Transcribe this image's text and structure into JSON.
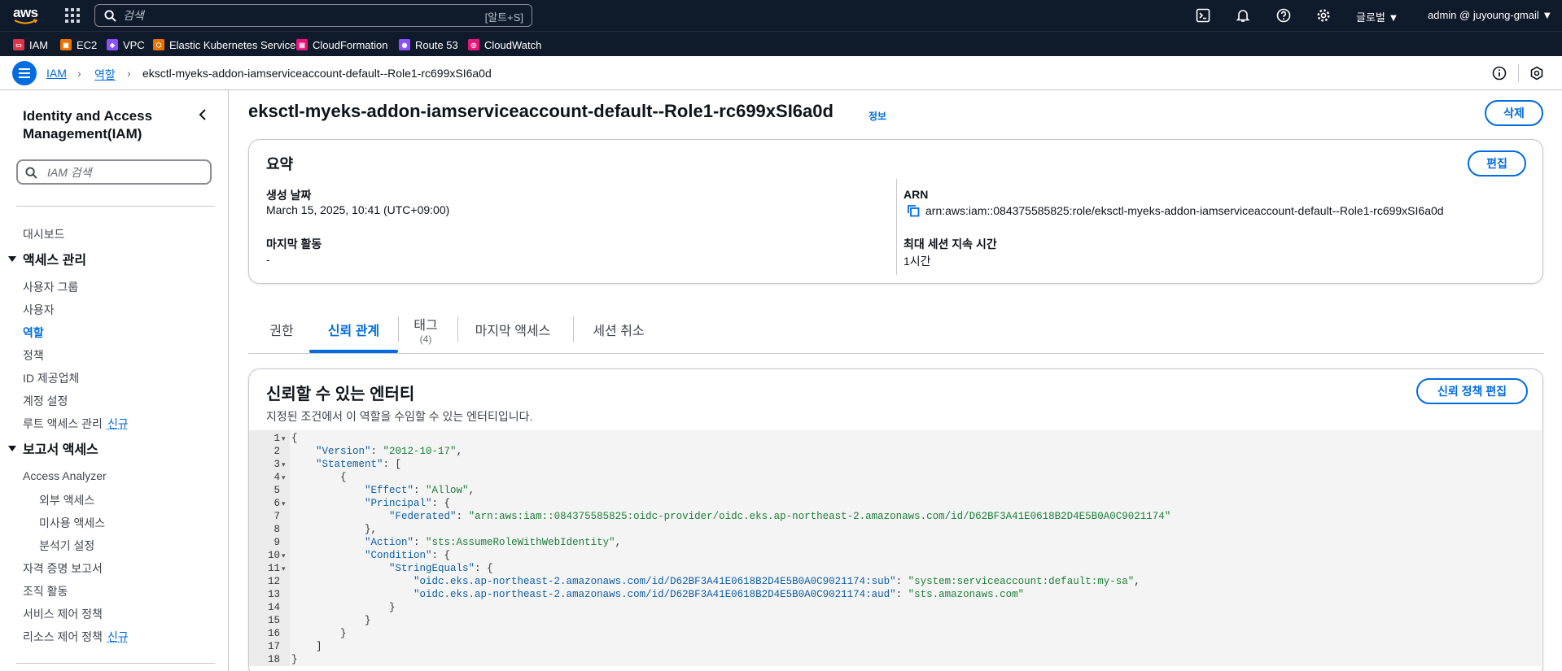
{
  "topnav": {
    "logo_text": "aws",
    "search_placeholder": "검색",
    "search_shortcut": "[알트+S]",
    "region_label": "글로벌 ▼",
    "user_label": "admin @ juyoung-gmail ▼"
  },
  "favorites": [
    {
      "label": "IAM",
      "color": "#dd344c",
      "abbr": "IAM"
    },
    {
      "label": "EC2",
      "color": "#ed7100",
      "abbr": "EC2"
    },
    {
      "label": "VPC",
      "color": "#8c4fff",
      "abbr": "VPC"
    },
    {
      "label": "Elastic Kubernetes Service",
      "color": "#ed7100",
      "abbr": "EKS"
    },
    {
      "label": "CloudFormation",
      "color": "#e7157b",
      "abbr": "CF"
    },
    {
      "label": "Route 53",
      "color": "#8c4fff",
      "abbr": "R53"
    },
    {
      "label": "CloudWatch",
      "color": "#e7157b",
      "abbr": "CW"
    }
  ],
  "breadcrumb": {
    "items": [
      "IAM",
      "역할"
    ],
    "current": "eksctl-myeks-addon-iamserviceaccount-default--Role1-rc699xSI6a0d"
  },
  "sidebar": {
    "title": "Identity and Access Management(IAM)",
    "search_placeholder": "IAM 검색",
    "dashboard": "대시보드",
    "access_mgmt": {
      "header": "액세스 관리",
      "items": [
        "사용자 그룹",
        "사용자",
        "역할",
        "정책",
        "ID 제공업체",
        "계정 설정",
        "루트 액세스 관리"
      ]
    },
    "report_access": {
      "header": "보고서 액세스",
      "items": [
        "Access Analyzer",
        "외부 액세스",
        "미사용 액세스",
        "분석기 설정",
        "자격 증명 보고서",
        "조직 활동",
        "서비스 제어 정책",
        "리소스 제어 정책"
      ]
    },
    "new_badge": "신규"
  },
  "page": {
    "title": "eksctl-myeks-addon-iamserviceaccount-default--Role1-rc699xSI6a0d",
    "info_link": "정보",
    "delete_button": "삭제"
  },
  "summary": {
    "header": "요약",
    "edit_button": "편집",
    "created_label": "생성 날짜",
    "created_value": "March 15, 2025, 10:41 (UTC+09:00)",
    "last_activity_label": "마지막 활동",
    "last_activity_value": "-",
    "arn_label": "ARN",
    "arn_value": "arn:aws:iam::084375585825:role/eksctl-myeks-addon-iamserviceaccount-default--Role1-rc699xSI6a0d",
    "max_session_label": "최대 세션 지속 시간",
    "max_session_value": "1시간"
  },
  "tabs": [
    {
      "label": "권한",
      "count": ""
    },
    {
      "label": "신뢰 관계",
      "count": ""
    },
    {
      "label": "태그",
      "count": "(4)"
    },
    {
      "label": "마지막 액세스",
      "count": ""
    },
    {
      "label": "세션 취소",
      "count": ""
    }
  ],
  "trusted": {
    "header": "신뢰할 수 있는 엔터티",
    "description": "지정된 조건에서 이 역할을 수임할 수 있는 엔터티입니다.",
    "edit_button": "신뢰 정책 편집",
    "code_lines": [
      "{",
      "    \"Version\": \"2012-10-17\",",
      "    \"Statement\": [",
      "        {",
      "            \"Effect\": \"Allow\",",
      "            \"Principal\": {",
      "                \"Federated\": \"arn:aws:iam::084375585825:oidc-provider/oidc.eks.ap-northeast-2.amazonaws.com/id/D62BF3A41E0618B2D4E5B0A0C9021174\"",
      "            },",
      "            \"Action\": \"sts:AssumeRoleWithWebIdentity\",",
      "            \"Condition\": {",
      "                \"StringEquals\": {",
      "                    \"oidc.eks.ap-northeast-2.amazonaws.com/id/D62BF3A41E0618B2D4E5B0A0C9021174:sub\": \"system:serviceaccount:default:my-sa\",",
      "                    \"oidc.eks.ap-northeast-2.amazonaws.com/id/D62BF3A41E0618B2D4E5B0A0C9021174:aud\": \"sts.amazonaws.com\"",
      "                }",
      "            }",
      "        }",
      "    ]",
      "}"
    ],
    "fold_lines": [
      1,
      3,
      4,
      6,
      10,
      11
    ]
  }
}
